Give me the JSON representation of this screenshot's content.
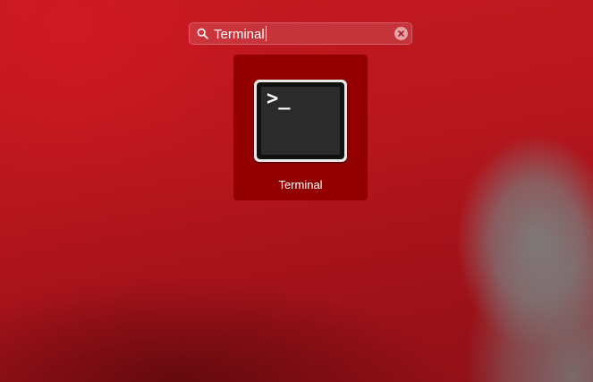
{
  "search": {
    "value": "Terminal",
    "search_icon": "search-icon",
    "clear_icon": "clear-circle-x-icon"
  },
  "results": [
    {
      "label": "Terminal",
      "icon": "terminal-app-icon",
      "prompt_glyph": ">_",
      "selected": true
    }
  ],
  "colors": {
    "wallpaper": "#b5151c",
    "selection_tile": "#930000",
    "text": "#ffffff"
  }
}
